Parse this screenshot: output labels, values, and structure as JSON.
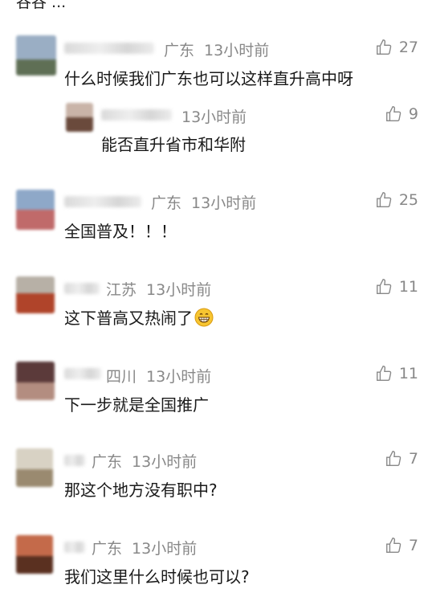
{
  "top_text": "谷谷 ...",
  "comments": [
    {
      "region": "广东",
      "time": "13小时前",
      "likes": "27",
      "text": "什么时候我们广东也可以这样直升高中呀",
      "avatar_colors": [
        "#9aaec4",
        "#5f6f55"
      ]
    },
    {
      "region": "",
      "time": "13小时前",
      "likes": "9",
      "text": "能否直升省市和华附",
      "avatar_colors": [
        "#c9b4a8",
        "#6a4a3c"
      ]
    },
    {
      "region": "广东",
      "time": "13小时前",
      "likes": "25",
      "text": "全国普及！！！",
      "avatar_colors": [
        "#8ea8c8",
        "#c06a6a"
      ]
    },
    {
      "region": "江苏",
      "time": "13小时前",
      "likes": "11",
      "text": "这下普高又热闹了",
      "avatar_colors": [
        "#b7b0a6",
        "#b0442a"
      ]
    },
    {
      "region": "四川",
      "time": "13小时前",
      "likes": "11",
      "text": "下一步就是全国推广",
      "avatar_colors": [
        "#5b3a3a",
        "#b38d80"
      ]
    },
    {
      "region": "广东",
      "time": "13小时前",
      "likes": "7",
      "text": "那这个地方没有职中?",
      "avatar_colors": [
        "#d8d2c4",
        "#9a8a70"
      ]
    },
    {
      "region": "广东",
      "time": "13小时前",
      "likes": "7",
      "text": "我们这里什么时候也可以?",
      "avatar_colors": [
        "#c46a4a",
        "#5a3020"
      ]
    }
  ]
}
